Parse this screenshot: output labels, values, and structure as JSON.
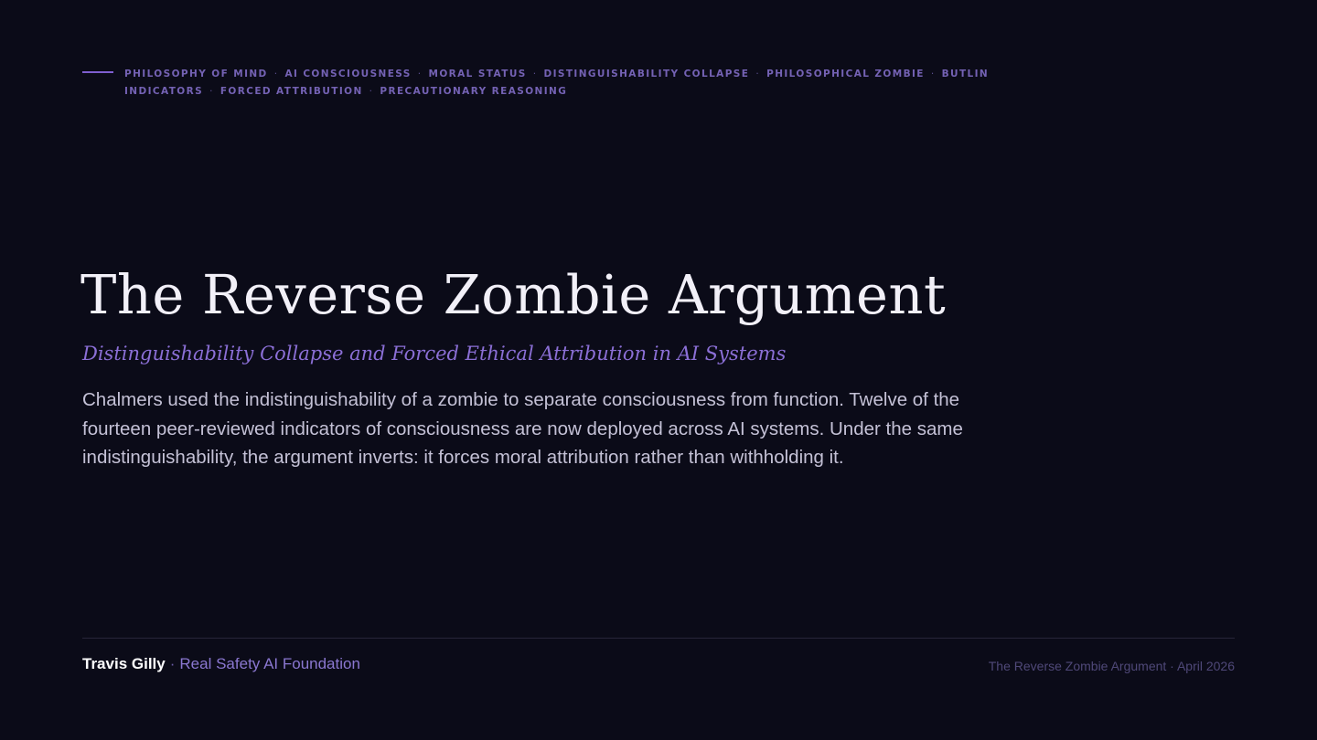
{
  "tags": [
    "Philosophy of Mind",
    "AI Consciousness",
    "Moral Status",
    "Distinguishability Collapse",
    "Philosophical Zombie",
    "Butlin Indicators",
    "Forced Attribution",
    "Precautionary Reasoning"
  ],
  "tag_separator": "·",
  "title": "The Reverse Zombie Argument",
  "subtitle": "Distinguishability Collapse and Forced Ethical Attribution in AI Systems",
  "lede": "Chalmers used the indistinguishability of a zombie to separate consciousness from function. Twelve of the fourteen peer-reviewed indicators of consciousness are now deployed across AI systems. Under the same indistinguishability, the argument inverts: it forces moral attribution rather than withholding it.",
  "footer": {
    "author": "Travis Gilly",
    "separator": "·",
    "organization": "Real Safety AI Foundation",
    "meta": "The Reverse Zombie Argument · April 2026"
  },
  "colors": {
    "background": "#0b0b18",
    "accent": "#8b6fd6",
    "tag_text": "#7462b4",
    "title_text": "#f2f0f8",
    "body_text": "#c4c1d6",
    "footer_meta": "#4f4878"
  }
}
